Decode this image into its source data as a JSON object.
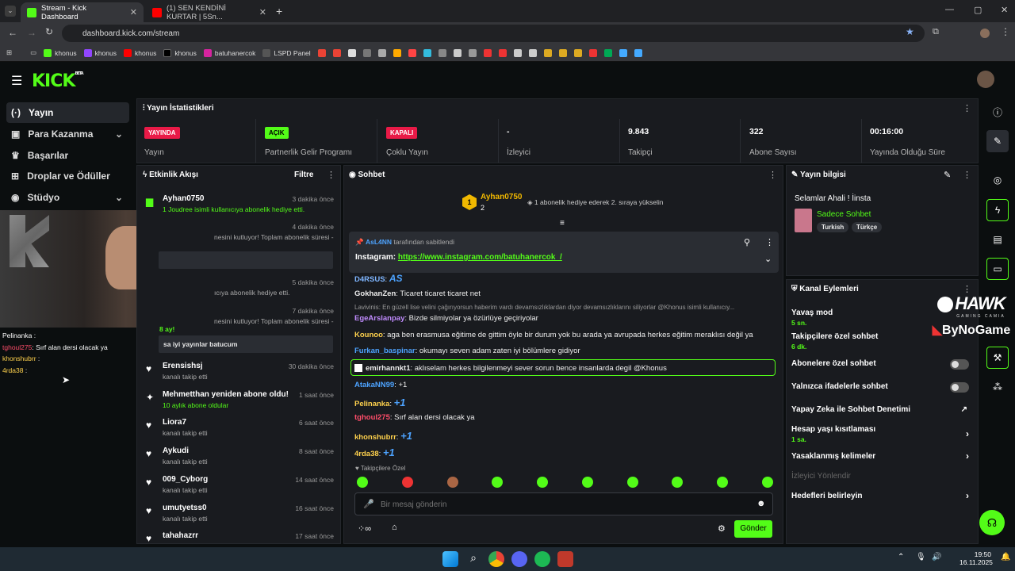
{
  "browser": {
    "tab1": "Stream - Kick Dashboard",
    "tab2": "(1) SEN KENDİNİ KURTAR | 5Sn...",
    "url": "dashboard.kick.com/stream",
    "bookmarks": [
      "khonus",
      "khonus",
      "khonus",
      "khonus",
      "batuhanercok",
      "LSPD Panel"
    ]
  },
  "brand": {
    "logo": "KICK",
    "beta": "BETA"
  },
  "sidebar": {
    "items": [
      {
        "label": "Yayın"
      },
      {
        "label": "Para Kazanma"
      },
      {
        "label": "Başarılar"
      },
      {
        "label": "Droplar ve Ödüller"
      },
      {
        "label": "Stüdyo"
      }
    ]
  },
  "overlay_chat": [
    {
      "user": "Pelinanka",
      "text": ":"
    },
    {
      "user": "tghoul275",
      "text": ": Sırf alan dersi olacak ya"
    },
    {
      "user": "khonshubrr",
      "text": ":"
    },
    {
      "user": "4rda38",
      "text": ":"
    }
  ],
  "stats": {
    "title": "Yayın İstatistikleri",
    "items": [
      {
        "badge": "YAYINDA",
        "label": "Yayın"
      },
      {
        "badge": "AÇIK",
        "label": "Partnerlik Gelir Programı"
      },
      {
        "badge": "KAPALI",
        "label": "Çoklu Yayın"
      },
      {
        "value": "-",
        "label": "İzleyici"
      },
      {
        "value": "9.843",
        "label": "Takipçi"
      },
      {
        "value": "322",
        "label": "Abone Sayısı"
      },
      {
        "value": "00:16:00",
        "label": "Yayında Olduğu Süre"
      }
    ]
  },
  "feed": {
    "title": "Etkinlik Akışı",
    "filter": "Filtre",
    "events": [
      {
        "name": "Ayhan0750",
        "time": "3 dakika önce",
        "sub": "1 Joudree isimli kullanıcıya abonelik hediye etti."
      },
      {
        "name": "",
        "time": "4 dakika önce",
        "sub": "nesini kutluyor! Toplam abonelik süresi -"
      },
      {
        "name": "",
        "time": "5 dakika önce",
        "sub": "ıcıya abonelik hediye etti."
      },
      {
        "name": "",
        "time": "7 dakika önce",
        "sub": "nesini kutluyor! Toplam abonelik süresi -"
      },
      {
        "name": "8 ay!",
        "time": "",
        "sub": "sa iyi yayınlar batucum"
      },
      {
        "name": "Erensishsj",
        "time": "30 dakika önce",
        "sub": "kanalı takip etti"
      },
      {
        "name": "Mehmetthan yeniden abone oldu!",
        "time": "1 saat önce",
        "sub": "10 aylık abone oldular"
      },
      {
        "name": "Liora7",
        "time": "6 saat önce",
        "sub": "kanalı takip etti"
      },
      {
        "name": "Aykudi",
        "time": "8 saat önce",
        "sub": "kanalı takip etti"
      },
      {
        "name": "009_Cyborg",
        "time": "14 saat önce",
        "sub": "kanalı takip etti"
      },
      {
        "name": "umutyetss0",
        "time": "16 saat önce",
        "sub": "kanalı takip etti"
      },
      {
        "name": "tahahazrr",
        "time": "17 saat önce",
        "sub": ""
      }
    ]
  },
  "chat": {
    "title": "Sohbet",
    "top_gifter": "Ayhan0750",
    "top_count": "2",
    "gift_hint": "1 abonelik hediye ederek 2. sıraya yükselin",
    "pinned_by": "AsL4NN",
    "pinned_suffix": "tarafından sabitlendi",
    "pinned_label": "Instagram:",
    "pinned_link": "https://www.instagram.com/batuhanercok_/",
    "messages": [
      {
        "user": "D4RSUS",
        "text": "AS",
        "color": "#7fb6ff"
      },
      {
        "user": "GokhanZen",
        "text": ": Ticaret ticaret ticaret net",
        "color": "#e8e8e8"
      },
      {
        "user": "Lavivinis",
        "text": ": En güzell lise velini çağırıyorsun haberim vardı devamsızlıklardan diyor devamsızlıklarını siliyorlar @Khonus isimli kullanıcıy...",
        "color": "#999"
      },
      {
        "user": "EgeArslanpay",
        "text": ": Bizde silmiyolar ya özürlüye geçiriyolar",
        "color": "#c18cff"
      },
      {
        "user": "Kounoo",
        "text": ": aga ben erasmusa eğitime de gittim öyle bir durum yok bu arada ya avrupada herkes eğitim meraklısı değil ya",
        "color": "#ffd24d"
      },
      {
        "user": "Furkan_baspinar",
        "text": ": okumayı seven adam zaten iyi bölümlere gidiyor",
        "color": "#4da3ff"
      },
      {
        "user": "emirhannkt1",
        "text": ": aklıselam herkes bilgilenmeyi sever sorun bence insanlarda degil @Khonus",
        "color": "#e8e8e8"
      },
      {
        "user": "AtakaNN99",
        "text": ": +1",
        "color": "#4da3ff"
      },
      {
        "user": "Pelinanka",
        "text": ":",
        "color": "#ffd24d"
      },
      {
        "user": "tghoul275",
        "text": ": Sırf alan dersi olacak ya",
        "color": "#ff4d6a"
      },
      {
        "user": "khonshubrr",
        "text": ":",
        "color": "#ffd24d"
      },
      {
        "user": "4rda38",
        "text": ":",
        "color": "#ffd24d"
      }
    ],
    "followers_only": "Takipçilere Özel",
    "placeholder": "Bir mesaj gönderin",
    "send": "Gönder"
  },
  "stream_info": {
    "title": "Yayın bilgisi",
    "stream_title": "Selamlar Ahali ! İinsta",
    "category": "Sadece Sohbet",
    "tags": [
      "Turkish",
      "Türkçe"
    ]
  },
  "channel_actions": {
    "title": "Kanal Eylemleri",
    "items": [
      {
        "label": "Yavaş mod",
        "sub": "5 sn."
      },
      {
        "label": "Takipçilere özel sohbet",
        "sub": "6 dk."
      },
      {
        "label": "Abonelere özel sohbet"
      },
      {
        "label": "Yalnızca ifadelerle sohbet"
      },
      {
        "label": "Yapay Zeka ile Sohbet Denetimi"
      },
      {
        "label": "Hesap yaşı kısıtlaması",
        "sub": "1 sa."
      },
      {
        "label": "Yasaklanmış kelimeler"
      },
      {
        "label": "İzleyici Yönlendir"
      },
      {
        "label": "Hedefleri belirleyin"
      }
    ]
  },
  "watermark": {
    "line1": "HAWK",
    "line2": "GAMING CAMIA",
    "line3": "ByNoGame"
  },
  "taskbar": {
    "time": "19:50",
    "date": "16.11.2025"
  },
  "colors": {
    "accent": "#53fc18",
    "live": "#e91a47",
    "panel": "#191b1f"
  }
}
